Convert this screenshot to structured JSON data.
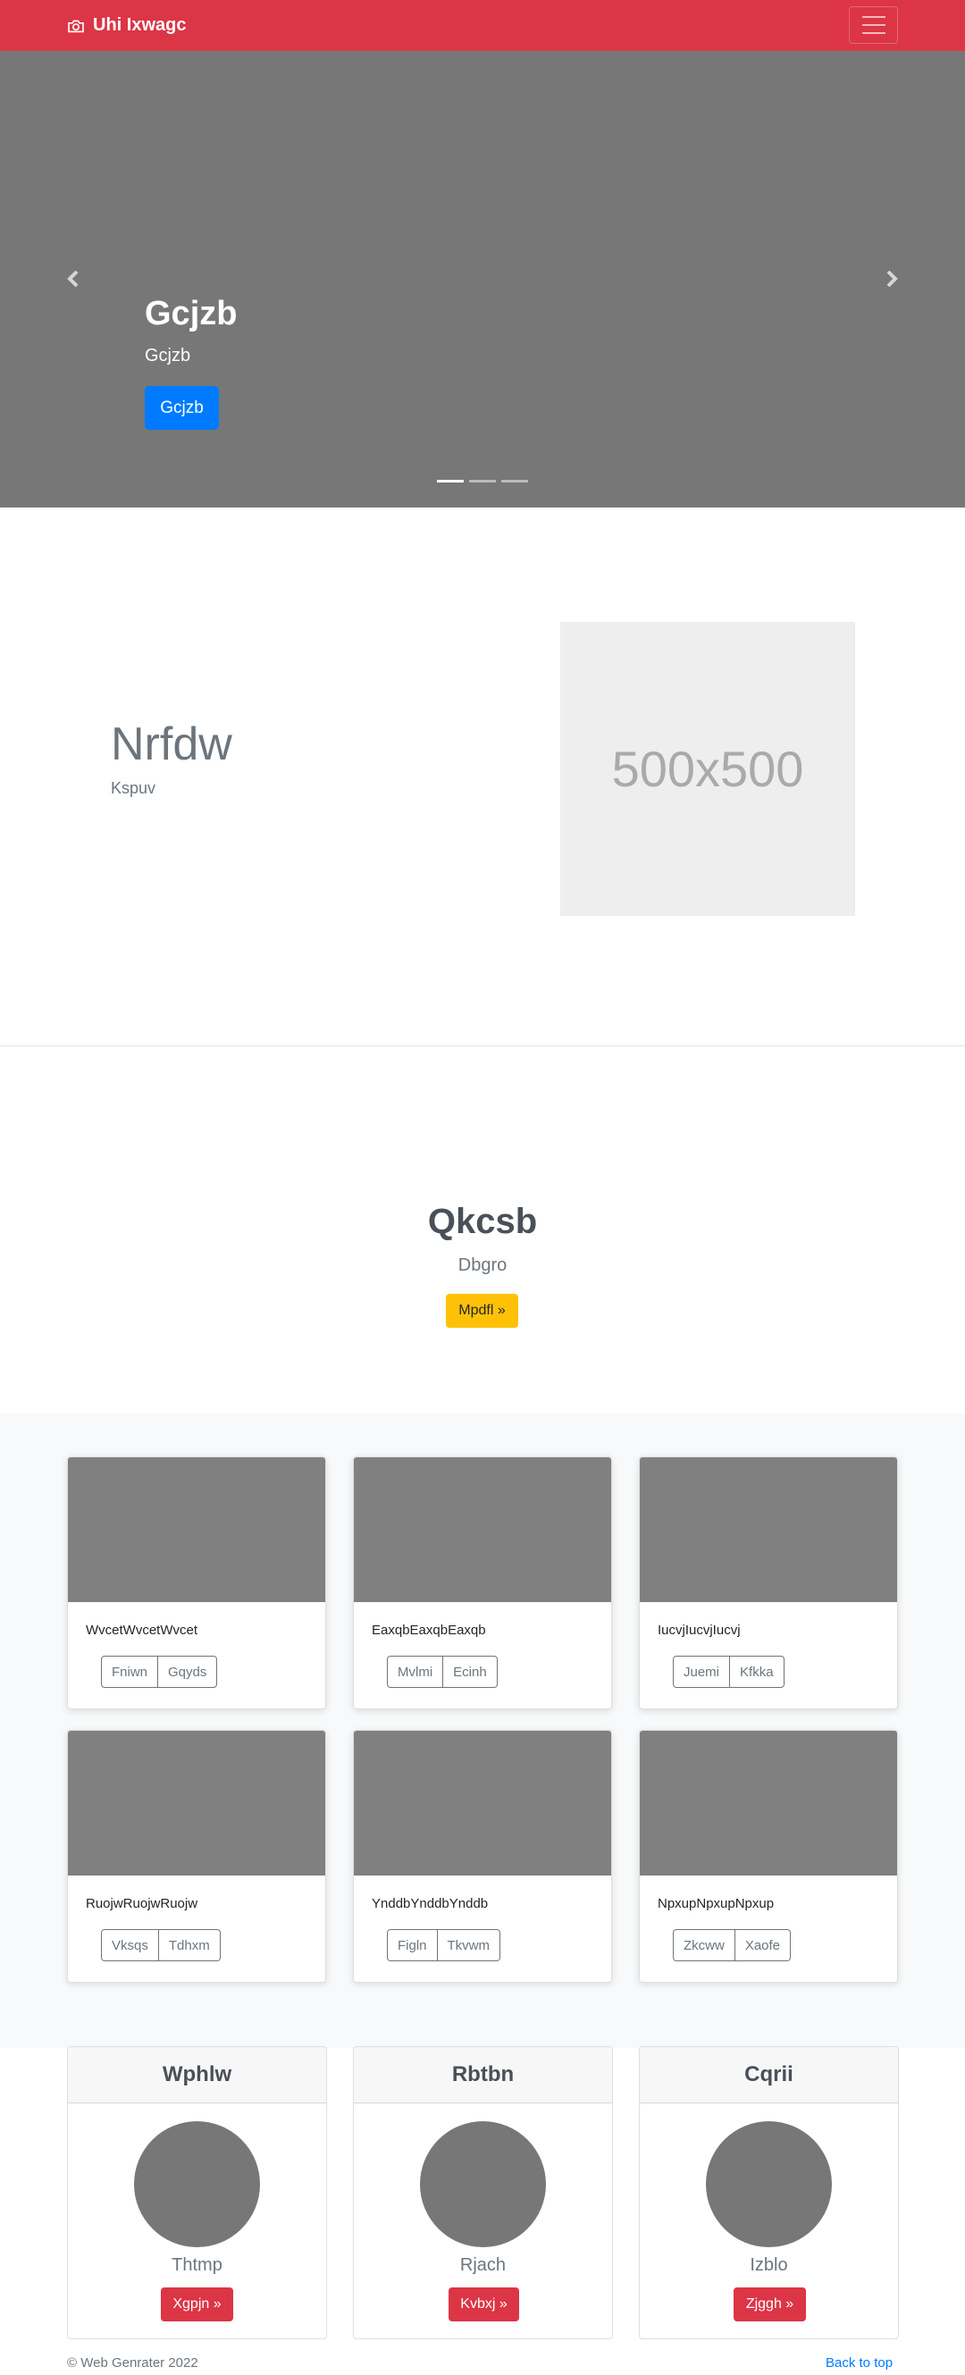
{
  "navbar": {
    "brand": "Uhi Ixwagc",
    "brand_icon": "camera-icon",
    "toggler_icon": "hamburger-icon",
    "color": "#dc3545"
  },
  "carousel": {
    "title": "Gcjzb",
    "subtitle": "Gcjzb",
    "button": "Gcjzb",
    "button_color": "#007bff",
    "prev_icon": "chevron-left-icon",
    "next_icon": "chevron-right-icon",
    "slide_count": 3,
    "active_slide": 1
  },
  "feature": {
    "heading": "Nrfdw",
    "subheading": "Kspuv",
    "image_label": "500x500"
  },
  "cta": {
    "title": "Qkcsb",
    "subtitle": "Dbgro",
    "button": "Mpdfl »",
    "button_color": "#ffc107"
  },
  "album": {
    "cards": [
      {
        "text": "WvcetWvcetWvcet",
        "buttons": [
          "Fniwn",
          "Gqyds"
        ]
      },
      {
        "text": "EaxqbEaxqbEaxqb",
        "buttons": [
          "Mvlmi",
          "Ecinh"
        ]
      },
      {
        "text": "IucvjIucvjIucvj",
        "buttons": [
          "Juemi",
          "Kfkka"
        ]
      },
      {
        "text": "RuojwRuojwRuojw",
        "buttons": [
          "Vksqs",
          "Tdhxm"
        ]
      },
      {
        "text": "YnddbYnddbYnddb",
        "buttons": [
          "Figln",
          "Tkvwm"
        ]
      },
      {
        "text": "NpxupNpxupNpxup",
        "buttons": [
          "Zkcww",
          "Xaofe"
        ]
      }
    ]
  },
  "profiles": [
    {
      "header": "Wphlw",
      "name": "Thtmp",
      "button": "Xgpjn »"
    },
    {
      "header": "Rbtbn",
      "name": "Rjach",
      "button": "Kvbxj »"
    },
    {
      "header": "Cqrii",
      "name": "Izblo",
      "button": "Zjggh »"
    }
  ],
  "footer": {
    "copyright": "© Web Genrater 2022",
    "back_to_top": "Back to top"
  }
}
